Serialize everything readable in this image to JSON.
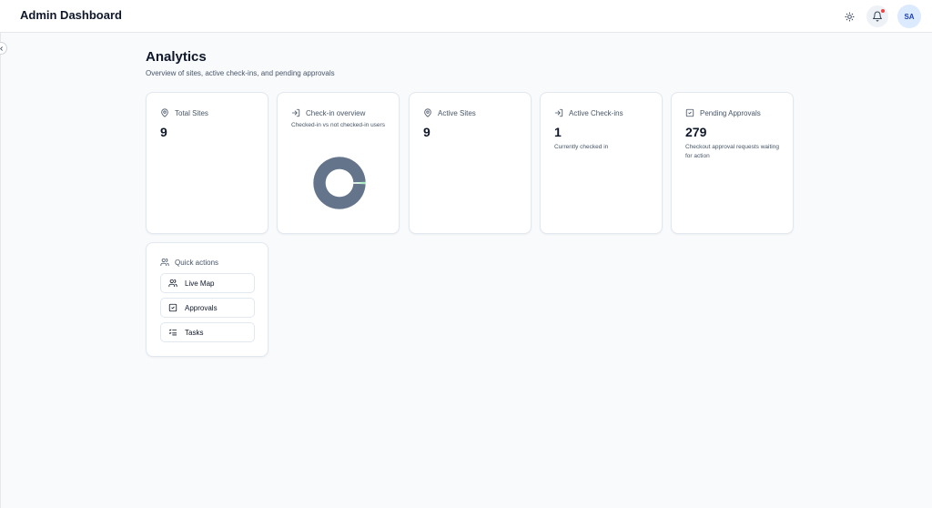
{
  "header": {
    "title": "Admin Dashboard",
    "theme_icon": "sun-icon",
    "notifications_icon": "bell-icon",
    "avatar_initials": "SA"
  },
  "sidebar": {
    "toggle_icon": "chevron-left-icon"
  },
  "page": {
    "title": "Analytics",
    "subtitle": "Overview of sites, active check-ins, and pending approvals"
  },
  "cards": {
    "total_sites": {
      "label": "Total Sites",
      "value": "9",
      "icon": "map-pin-icon"
    },
    "checkin_overview": {
      "label": "Check-in overview",
      "description": "Checked-in vs not checked-in users",
      "icon": "log-in-icon",
      "chart_data": {
        "type": "pie",
        "categories": [
          "Checked-in",
          "Not checked-in"
        ],
        "values": [
          1,
          99
        ],
        "colors": [
          "#4ade80",
          "#64748b"
        ]
      }
    },
    "active_sites": {
      "label": "Active Sites",
      "value": "9",
      "icon": "map-pin-icon"
    },
    "active_checkins": {
      "label": "Active Check-ins",
      "value": "1",
      "note": "Currently checked in",
      "icon": "log-in-icon"
    },
    "pending_approvals": {
      "label": "Pending Approvals",
      "value": "279",
      "note": "Checkout approval requests waiting for action",
      "icon": "square-check-icon"
    }
  },
  "quick_actions": {
    "title": "Quick actions",
    "icon": "users-icon",
    "items": [
      {
        "label": "Live Map",
        "icon": "users-icon"
      },
      {
        "label": "Approvals",
        "icon": "square-check-icon"
      },
      {
        "label": "Tasks",
        "icon": "list-checks-icon"
      }
    ]
  },
  "colors": {
    "background": "#f8fafc",
    "card": "#ffffff",
    "border": "#e2e8f0",
    "text": "#0f172a",
    "muted": "#475569",
    "donut_main": "#64748b",
    "donut_accent": "#4ade80",
    "avatar_bg": "#dbeafe",
    "notification_dot": "#ef4444"
  }
}
